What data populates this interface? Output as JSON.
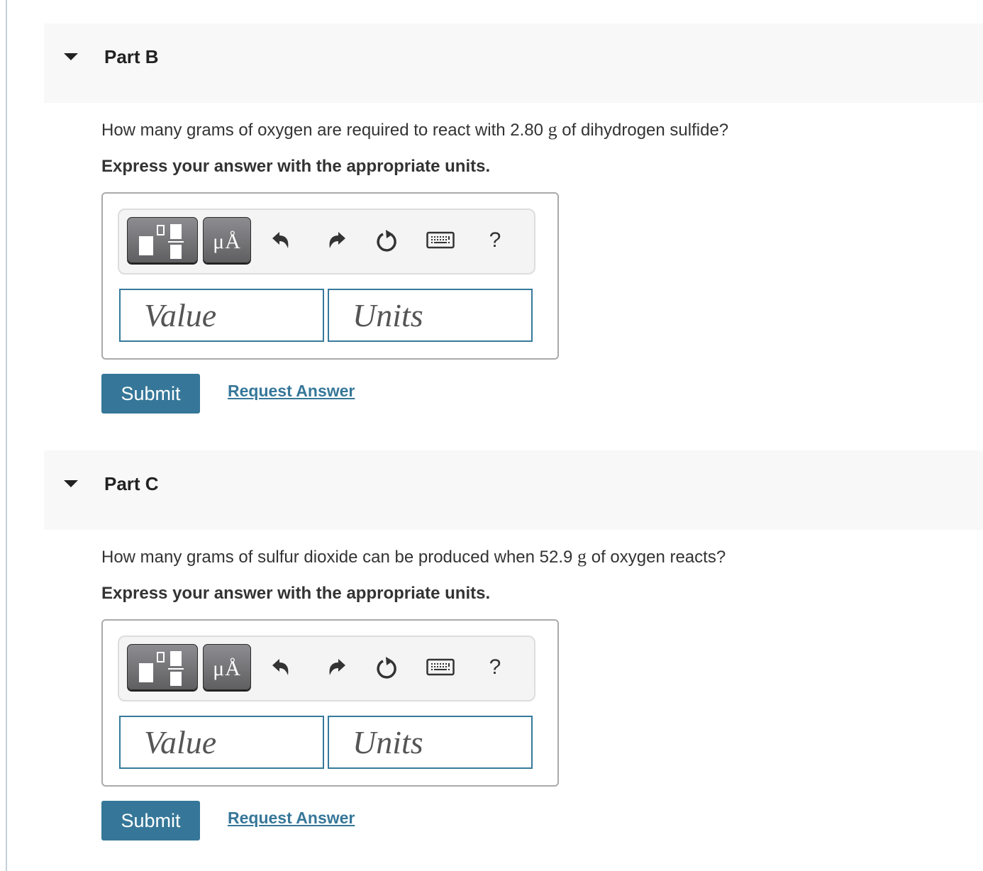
{
  "theme": {
    "accent": "#367799",
    "header_background": "#f8f8f8",
    "input_border": "#377a9c"
  },
  "parts": [
    {
      "title": "Part B",
      "expanded": true,
      "question": {
        "before": "How many grams of oxygen are required to react with 2.80 ",
        "unit": "g",
        "after": " of dihydrogen sulfide?"
      },
      "instruction": "Express your answer with the appropriate units.",
      "toolbar": {
        "template_icon": "fraction-template-icon",
        "units_label": "μÅ",
        "undo_icon": "undo-icon",
        "redo_icon": "redo-icon",
        "reset_icon": "reset-icon",
        "keyboard_icon": "keyboard-icon",
        "help_label": "?"
      },
      "value_placeholder": "Value",
      "value": "",
      "units_placeholder": "Units",
      "units": "",
      "submit_label": "Submit",
      "request_answer_label": "Request Answer"
    },
    {
      "title": "Part C",
      "expanded": true,
      "question": {
        "before": "How many grams of sulfur dioxide can be produced when 52.9 ",
        "unit": "g",
        "after": " of oxygen reacts?"
      },
      "instruction": "Express your answer with the appropriate units.",
      "toolbar": {
        "template_icon": "fraction-template-icon",
        "units_label": "μÅ",
        "undo_icon": "undo-icon",
        "redo_icon": "redo-icon",
        "reset_icon": "reset-icon",
        "keyboard_icon": "keyboard-icon",
        "help_label": "?"
      },
      "value_placeholder": "Value",
      "value": "",
      "units_placeholder": "Units",
      "units": "",
      "submit_label": "Submit",
      "request_answer_label": "Request Answer"
    }
  ]
}
